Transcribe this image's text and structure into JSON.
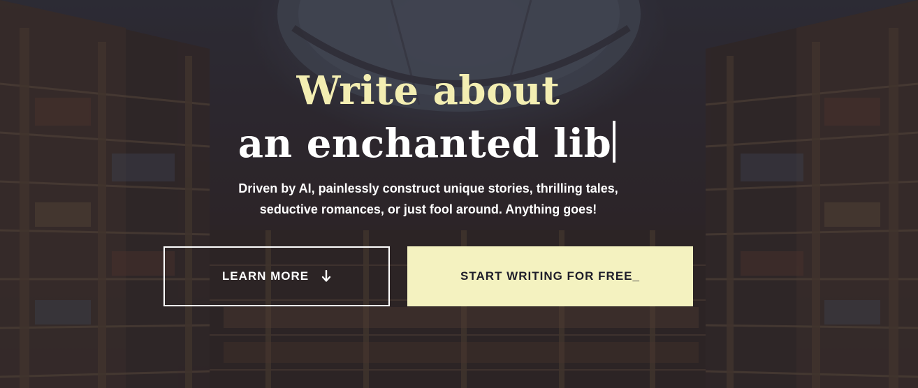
{
  "hero": {
    "headline_line1": "Write about",
    "headline_line2": "an enchanted lib",
    "tagline_line1": "Driven by AI, painlessly construct unique stories, thrilling tales,",
    "tagline_line2": "seductive romances, or just fool around. Anything goes!"
  },
  "buttons": {
    "learn_more": "LEARN MORE",
    "learn_more_icon": "arrow-down-icon",
    "start_writing": "START WRITING FOR FREE_"
  },
  "colors": {
    "accent": "#f3eeb2",
    "button_fill": "#f4f2c0",
    "button_text": "#1e1d2a",
    "text": "#ffffff"
  }
}
